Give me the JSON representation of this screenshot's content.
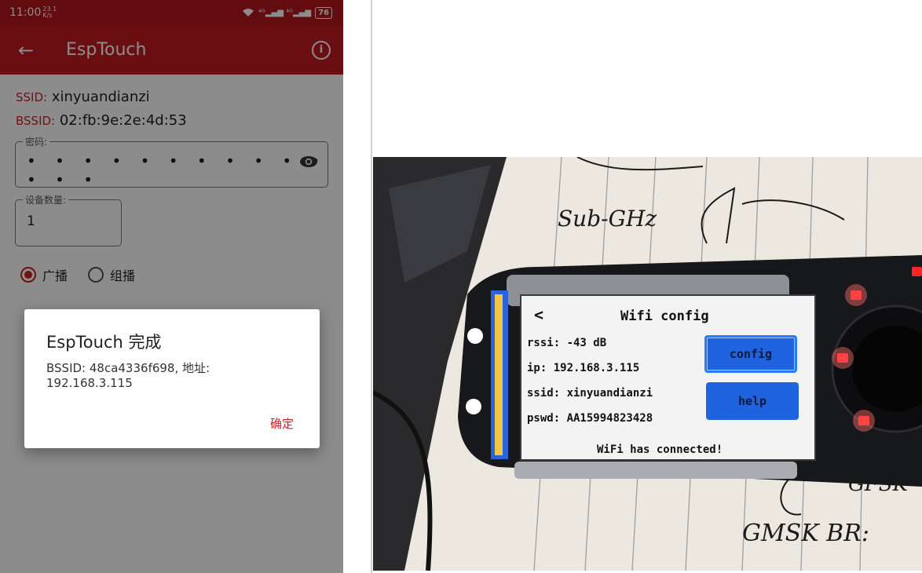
{
  "phone": {
    "status_bar": {
      "time": "11:00",
      "tiny_indicator": "23.1 K/s",
      "signal_text": "4G",
      "battery": "76"
    },
    "app_bar": {
      "back_icon": "arrow-left",
      "title": "EspTouch",
      "info_icon": "info"
    },
    "form": {
      "ssid_key": "SSID:",
      "ssid_value": "xinyuandianzi",
      "bssid_key": "BSSID:",
      "bssid_value": "02:fb:9e:2e:4d:53",
      "password_label": "密码:",
      "password_value": "• • • • • • • • • • • • • •",
      "device_count_label": "设备数量:",
      "device_count_value": "1",
      "radio_options": [
        {
          "label": "广播",
          "checked": true
        },
        {
          "label": "组播",
          "checked": false
        }
      ]
    },
    "dialog": {
      "title": "EspTouch 完成",
      "message": "BSSID: 48ca4336f698, 地址: 192.168.3.115",
      "ok_label": "确定"
    },
    "colors": {
      "status_bar": "#b3161c",
      "app_bar": "#c41a22",
      "accent": "#d21e26"
    }
  },
  "photo": {
    "lcd": {
      "back_glyph": "<",
      "title": "Wifi config",
      "rssi": "rssi: -43 dB",
      "ip": "ip: 192.168.3.115",
      "ssid": "ssid: xinyuandianzi",
      "pswd": "pswd: AA15994823428",
      "config_button": "config",
      "help_button": "help",
      "status": "WiFi has connected!"
    },
    "handwriting": {
      "line1": "Sub-GHz",
      "line2": "GFSK",
      "line3": "GMSK BR:"
    }
  }
}
